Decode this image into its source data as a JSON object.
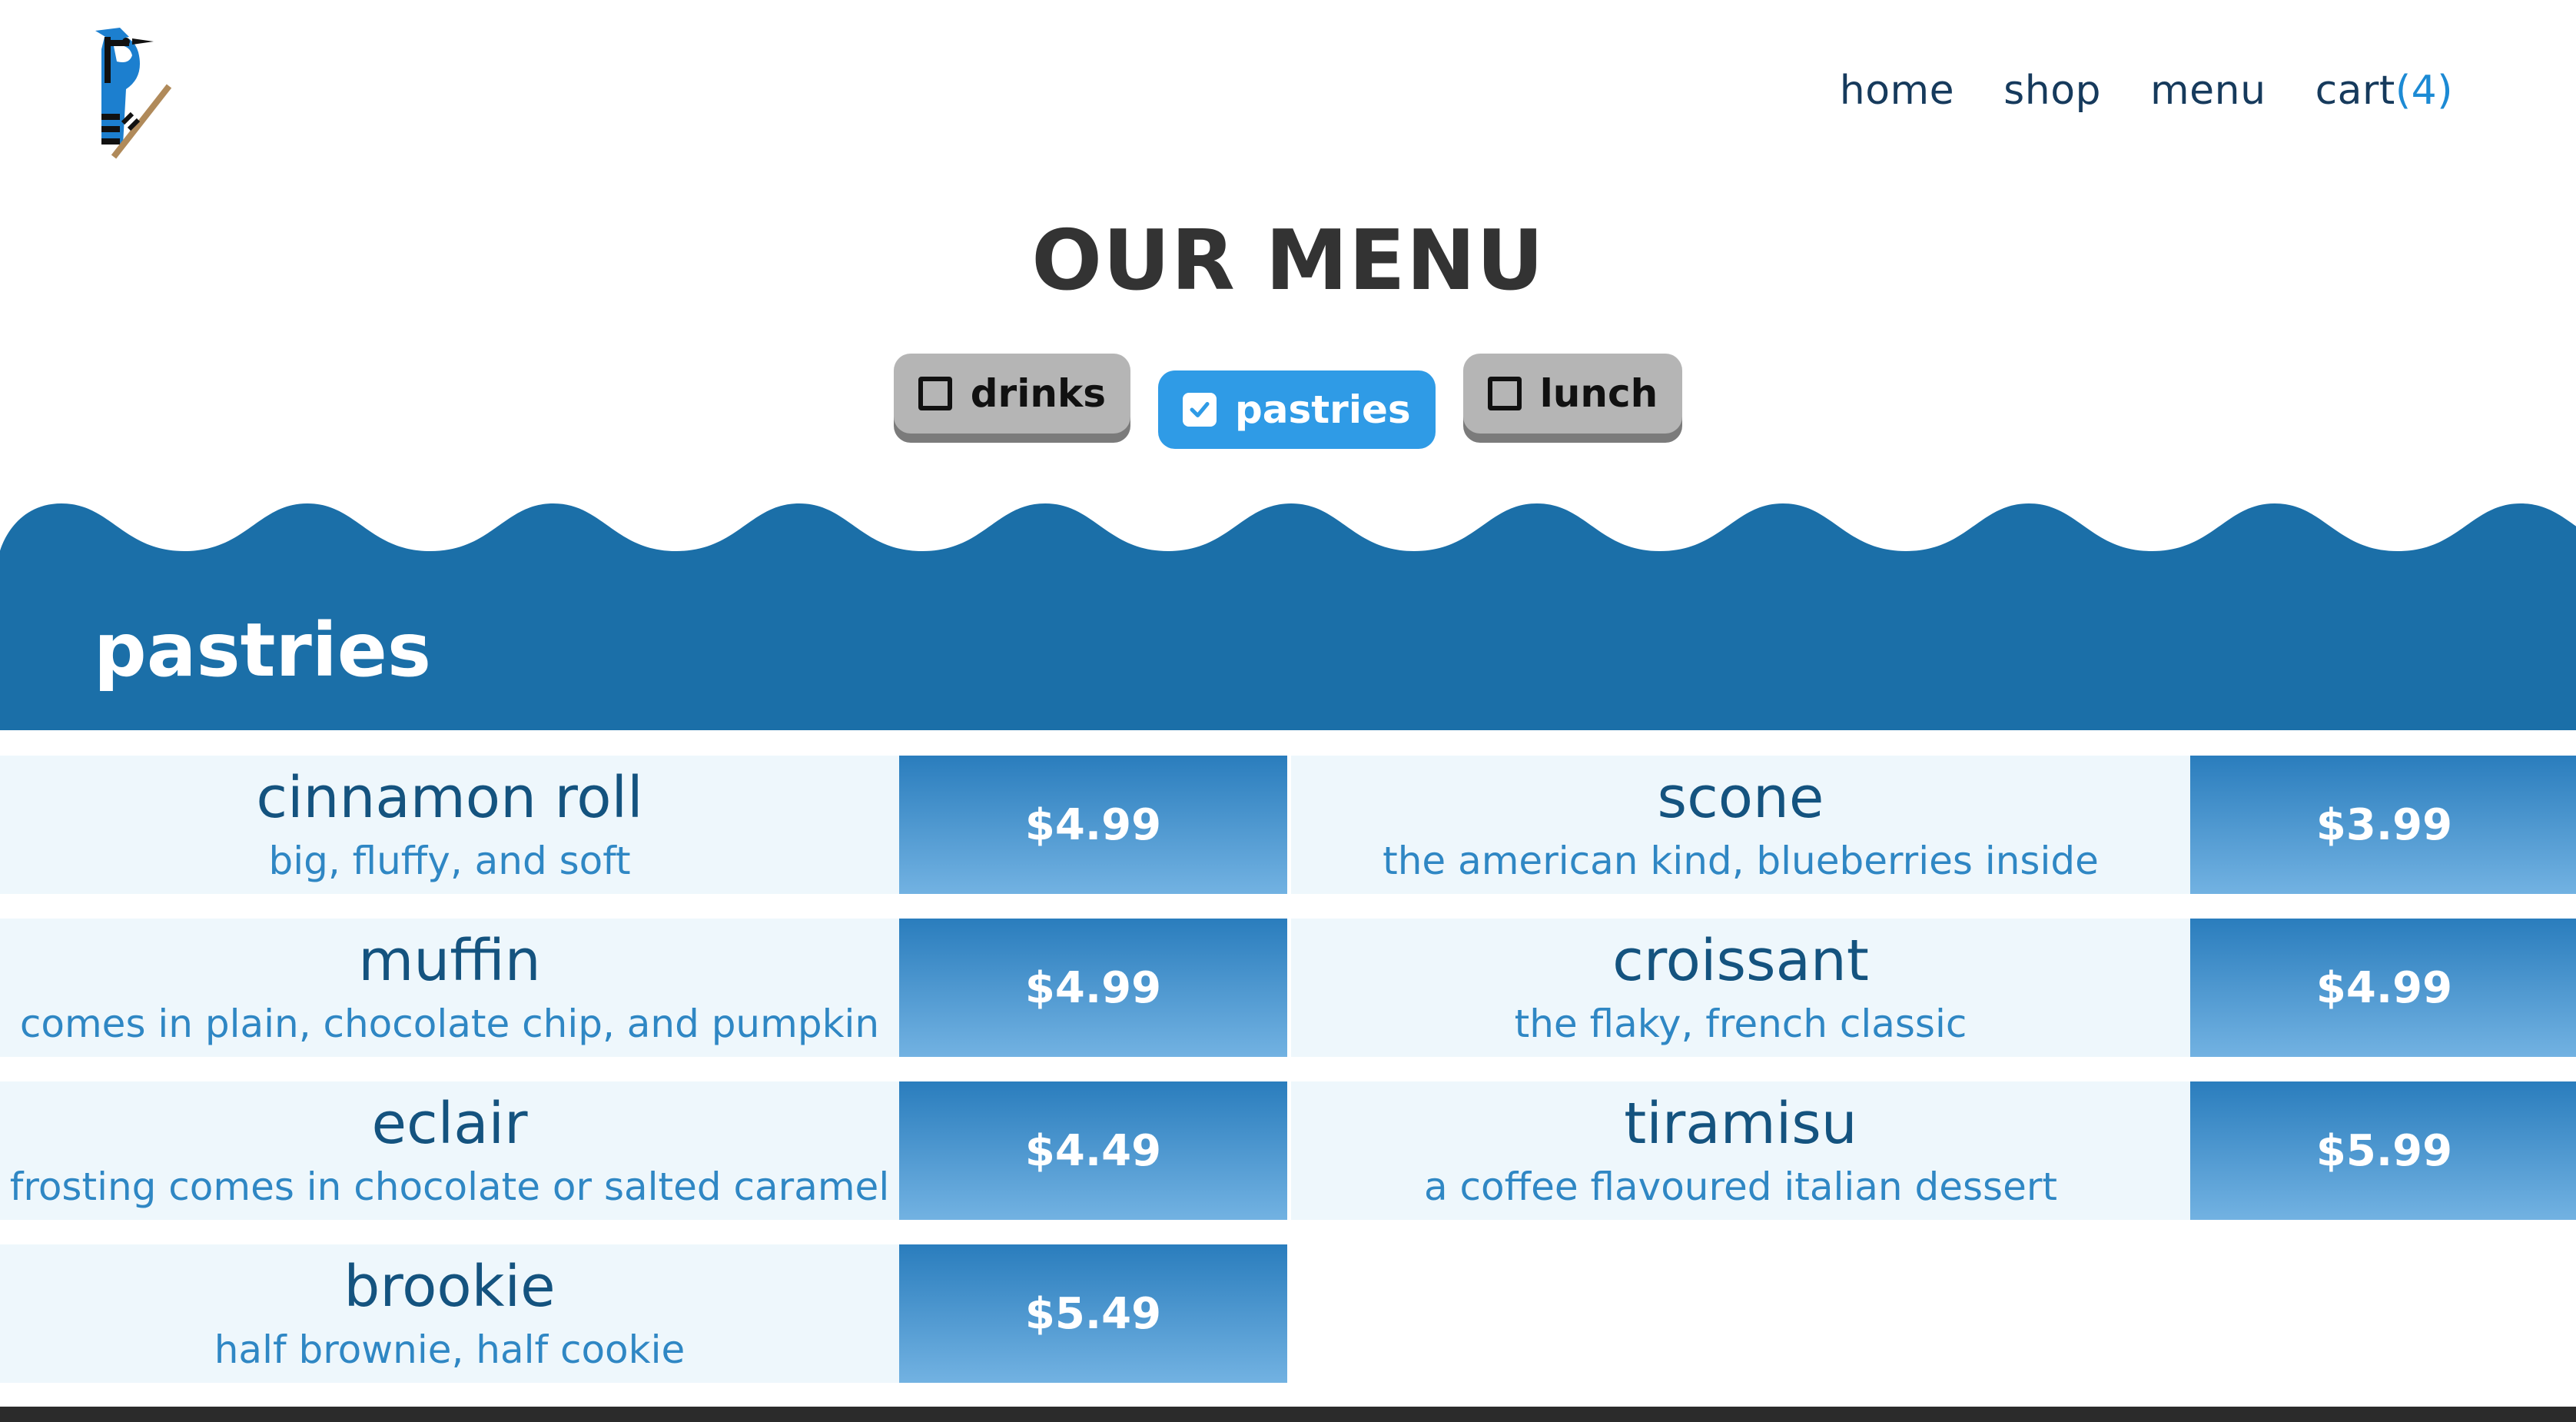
{
  "nav": {
    "home": "home",
    "shop": "shop",
    "menu": "menu",
    "cart_label": "cart",
    "cart_count": "(4)"
  },
  "page_title": "OUR MENU",
  "filters": [
    {
      "label": "drinks",
      "checked": false
    },
    {
      "label": "pastries",
      "checked": true
    },
    {
      "label": "lunch",
      "checked": false
    }
  ],
  "section_title": "pastries",
  "items": [
    {
      "name": "cinnamon roll",
      "desc": "big, fluffy, and soft",
      "price": "$4.99"
    },
    {
      "name": "scone",
      "desc": "the american kind, blueberries inside",
      "price": "$3.99"
    },
    {
      "name": "muffin",
      "desc": "comes in plain, chocolate chip, and pumpkin",
      "price": "$4.99"
    },
    {
      "name": "croissant",
      "desc": "the flaky, french classic",
      "price": "$4.99"
    },
    {
      "name": "eclair",
      "desc": "frosting comes in chocolate or salted caramel",
      "price": "$4.49"
    },
    {
      "name": "tiramisu",
      "desc": "a coffee flavoured italian dessert",
      "price": "$5.99"
    },
    {
      "name": "brookie",
      "desc": "half brownie, half cookie",
      "price": "$5.49"
    }
  ],
  "colors": {
    "brand_blue": "#1b6fa8",
    "accent_blue": "#2f9be6",
    "item_bg": "#eef7fc"
  },
  "icons": {
    "logo": "bluejay-logo-icon",
    "checkbox_checked": "checkmark-icon"
  }
}
